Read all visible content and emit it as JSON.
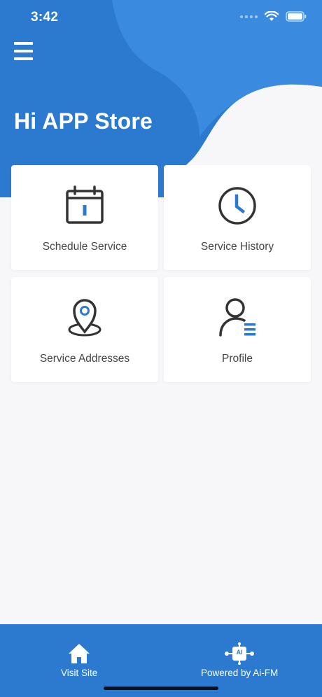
{
  "status_bar": {
    "time": "3:42"
  },
  "header": {
    "greeting": "Hi APP Store"
  },
  "tiles": [
    {
      "label": "Schedule Service",
      "icon": "calendar-icon"
    },
    {
      "label": "Service History",
      "icon": "clock-icon"
    },
    {
      "label": "Service Addresses",
      "icon": "location-pin-icon"
    },
    {
      "label": "Profile",
      "icon": "profile-icon"
    }
  ],
  "footer": {
    "visit_site": "Visit Site",
    "powered_by": "Powered by Ai-FM",
    "ai_badge": "AI"
  },
  "colors": {
    "brand_blue": "#2b7ad0",
    "icon_gray": "#333333",
    "accent_blue": "#2b7ad0"
  }
}
